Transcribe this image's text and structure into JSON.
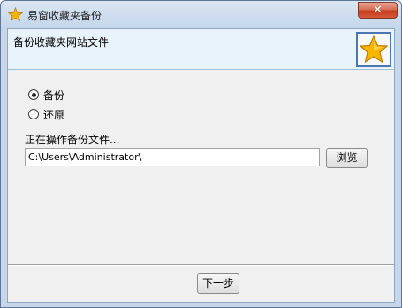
{
  "window": {
    "title": "易窗收藏夹备份",
    "close_label": "✕"
  },
  "header": {
    "title": "备份收藏夹网站文件",
    "icon": "star-icon"
  },
  "options": [
    {
      "label": "备份",
      "checked": true
    },
    {
      "label": "还原",
      "checked": false
    }
  ],
  "file_section": {
    "label": "正在操作备份文件...",
    "path_value": "C:\\Users\\Administrator\\",
    "browse_label": "浏览"
  },
  "footer": {
    "next_label": "下一步"
  },
  "colors": {
    "titlebar": "#c4d6ea",
    "header_bg": "#e8f3fb",
    "star": "#f5a800"
  }
}
